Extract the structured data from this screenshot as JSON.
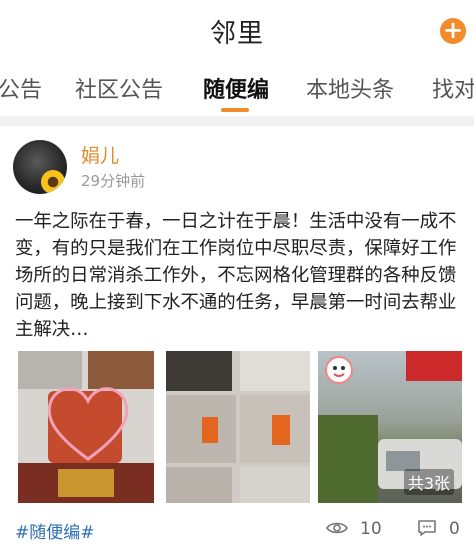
{
  "header": {
    "title": "邻里",
    "add_icon": "plus-circle-icon",
    "accent": "#f28b2a"
  },
  "tabs": [
    {
      "label": "公告",
      "active": false
    },
    {
      "label": "社区公告",
      "active": false
    },
    {
      "label": "随便编",
      "active": true
    },
    {
      "label": "本地头条",
      "active": false
    },
    {
      "label": "找对",
      "active": false
    }
  ],
  "post": {
    "author": "娟儿",
    "time": "29分钟前",
    "body": "一年之际在于春，一日之计在于晨！生活中没有一成不变，有的只是我们在工作岗位中尽职尽责，保障好工作场所的日常消杀工作外，不忘网格化管理群的各种反馈问题，晚上接到下水不通的任务，早晨第一时间去帮业主解决…",
    "images": {
      "photo_count_badge": "共3张"
    },
    "topic_tag": "#随便编#",
    "views": "10",
    "comments": "0"
  }
}
